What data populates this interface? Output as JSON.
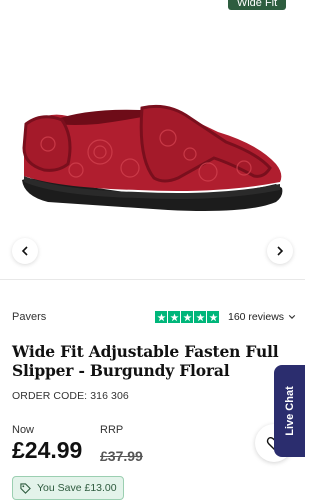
{
  "gallery": {
    "badge": "Wide Fit",
    "image_alt": "Burgundy floral wide fit adjustable slipper"
  },
  "product": {
    "brand": "Pavers",
    "rating_stars": 5,
    "reviews_label": "160 reviews",
    "title": "Wide Fit Adjustable Fasten Full Slipper - Burgundy Floral",
    "order_code": "ORDER CODE: 316 306",
    "now_label": "Now",
    "price_now": "£24.99",
    "rrp_label": "RRP",
    "price_rrp": "£37.99",
    "save_label": "You Save £13.00"
  },
  "chat": {
    "label": "Live Chat"
  },
  "colors": {
    "badge_green": "#2e5d3f",
    "star_green": "#00b67a",
    "chat_navy": "#2b2d6e",
    "save_bg": "#e3f3ea",
    "slipper_red": "#b01e2f"
  }
}
